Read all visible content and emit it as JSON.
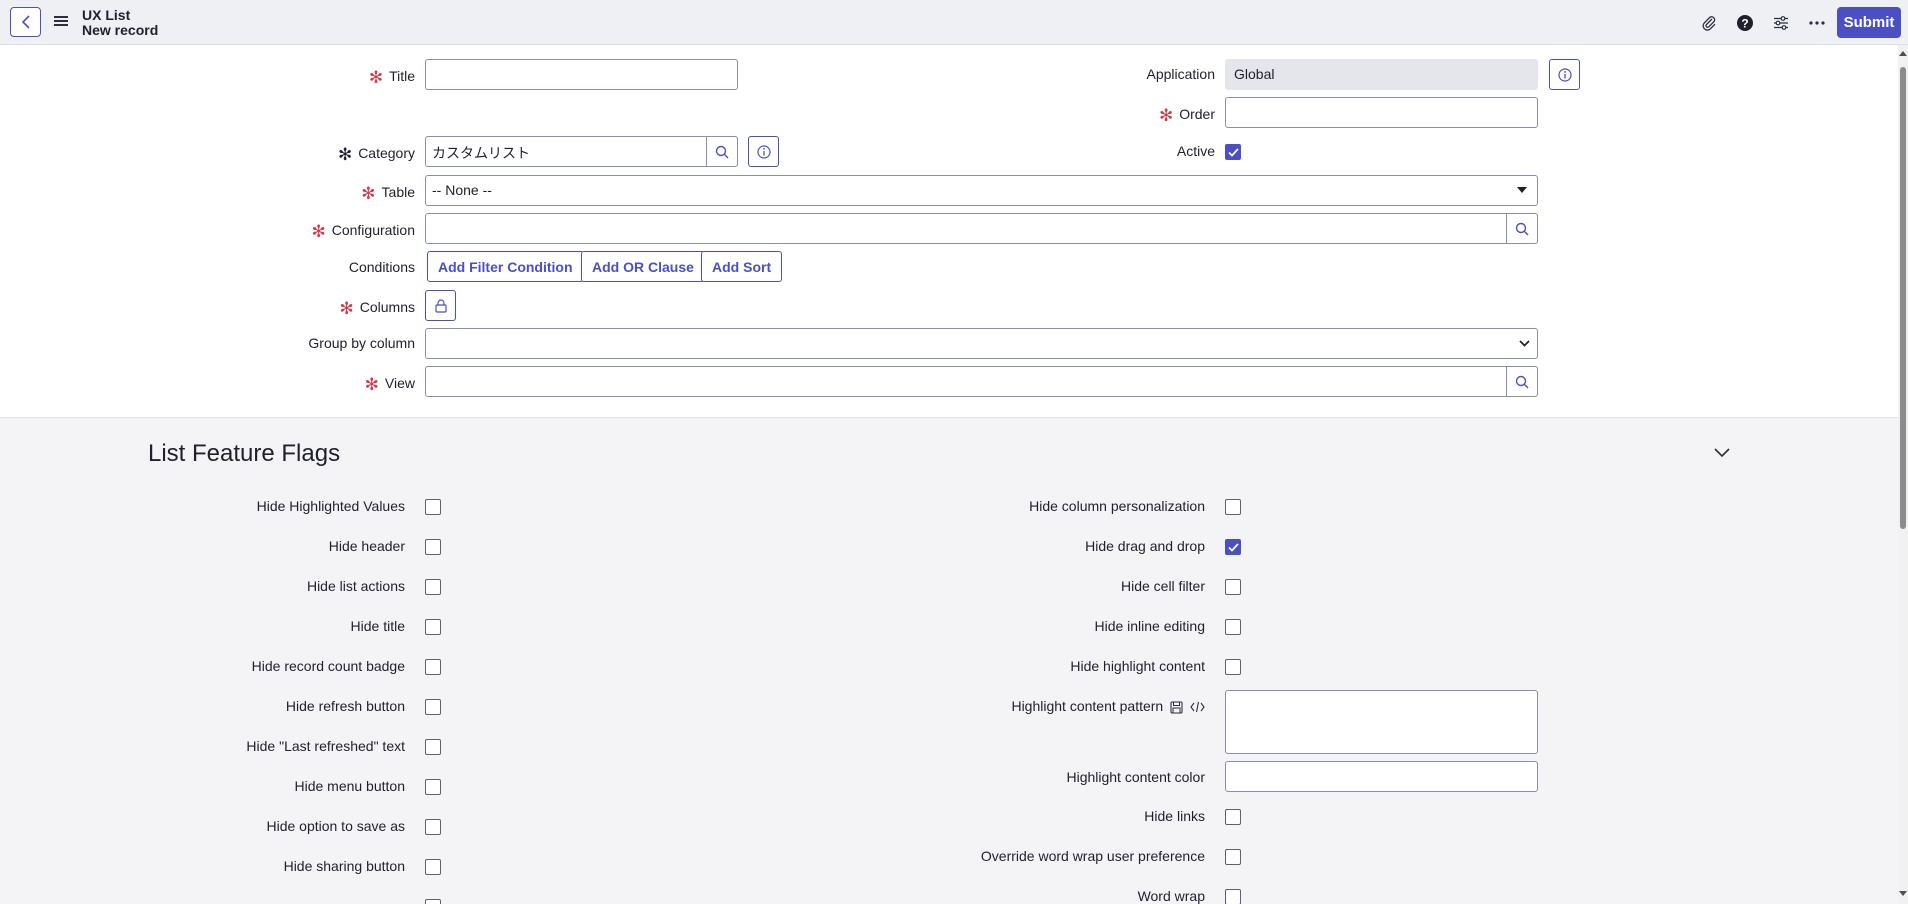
{
  "header": {
    "title": "UX List",
    "subtitle": "New record",
    "submit_label": "Submit",
    "icons": [
      "back-icon",
      "menu-icon",
      "attachment-icon",
      "help-icon",
      "settings-icon",
      "more-icon"
    ],
    "accent": "#4a4fc4"
  },
  "form": {
    "title_label": "Title",
    "title_value": "",
    "application_label": "Application",
    "application_value": "Global",
    "order_label": "Order",
    "order_value": "",
    "category_label": "Category",
    "category_value": "カスタムリスト",
    "active_label": "Active",
    "active_checked": true,
    "table_label": "Table",
    "table_value": "-- None --",
    "configuration_label": "Configuration",
    "configuration_value": "",
    "conditions_label": "Conditions",
    "add_filter_label": "Add Filter Condition",
    "add_or_label": "Add OR Clause",
    "add_sort_label": "Add Sort",
    "columns_label": "Columns",
    "group_by_label": "Group by column",
    "group_by_value": "",
    "view_label": "View",
    "view_value": "",
    "required_color": "#d23c4a"
  },
  "flags": {
    "section_title": "List Feature Flags",
    "left": [
      {
        "label": "Hide Highlighted Values",
        "checked": false
      },
      {
        "label": "Hide header",
        "checked": false
      },
      {
        "label": "Hide list actions",
        "checked": false
      },
      {
        "label": "Hide title",
        "checked": false
      },
      {
        "label": "Hide record count badge",
        "checked": false
      },
      {
        "label": "Hide refresh button",
        "checked": false
      },
      {
        "label": "Hide \"Last refreshed\" text",
        "checked": false
      },
      {
        "label": "Hide menu button",
        "checked": false
      },
      {
        "label": "Hide option to save as",
        "checked": false
      },
      {
        "label": "Hide sharing button",
        "checked": false
      }
    ],
    "right": [
      {
        "label": "Hide column personalization",
        "checked": false
      },
      {
        "label": "Hide drag and drop",
        "checked": true
      },
      {
        "label": "Hide cell filter",
        "checked": false
      },
      {
        "label": "Hide inline editing",
        "checked": false
      },
      {
        "label": "Hide highlight content",
        "checked": false
      }
    ],
    "highlight_pattern_label": "Highlight content pattern",
    "highlight_pattern_value": "",
    "highlight_color_label": "Highlight content color",
    "highlight_color_value": "",
    "right_bottom": [
      {
        "label": "Hide links",
        "checked": false
      },
      {
        "label": "Override word wrap user preference",
        "checked": false
      },
      {
        "label": "Word wrap",
        "checked": false
      }
    ]
  }
}
